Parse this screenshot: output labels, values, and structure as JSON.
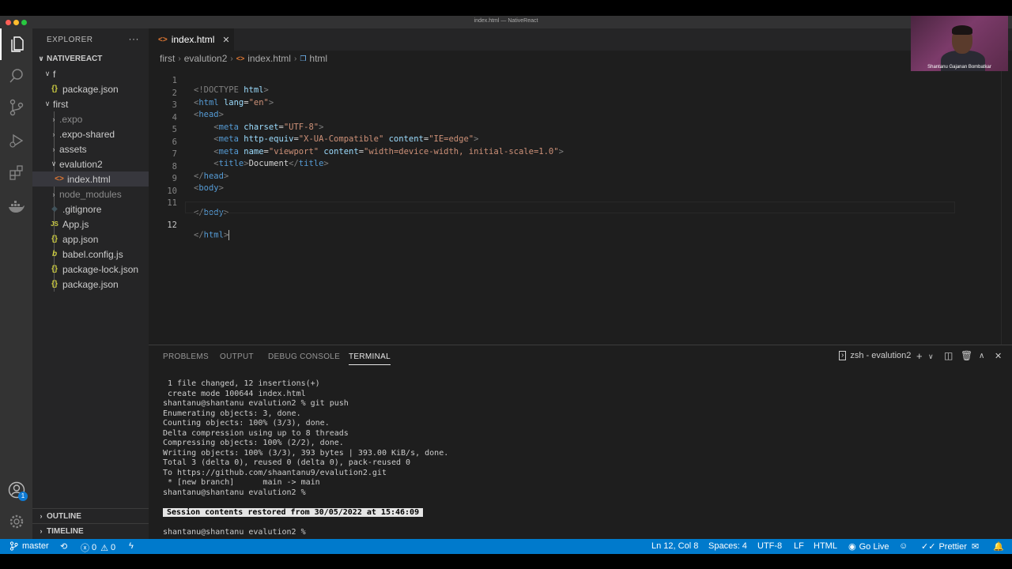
{
  "window": {
    "title": "index.html — NativeReact"
  },
  "explorer": {
    "header": "EXPLORER",
    "root": "NATIVEREACT",
    "items": [
      {
        "label": "f",
        "type": "folder-open"
      },
      {
        "label": "package.json",
        "type": "json"
      },
      {
        "label": "first",
        "type": "folder-open"
      },
      {
        "label": ".expo",
        "type": "folder"
      },
      {
        "label": ".expo-shared",
        "type": "folder"
      },
      {
        "label": "assets",
        "type": "folder"
      },
      {
        "label": "evalution2",
        "type": "folder-open"
      },
      {
        "label": "index.html",
        "type": "html"
      },
      {
        "label": "node_modules",
        "type": "folder"
      },
      {
        "label": ".gitignore",
        "type": "git"
      },
      {
        "label": "App.js",
        "type": "js"
      },
      {
        "label": "app.json",
        "type": "json"
      },
      {
        "label": "babel.config.js",
        "type": "babel"
      },
      {
        "label": "package-lock.json",
        "type": "json"
      },
      {
        "label": "package.json",
        "type": "json"
      }
    ],
    "outline": "OUTLINE",
    "timeline": "TIMELINE"
  },
  "editor": {
    "tab": "index.html",
    "breadcrumb": [
      "first",
      "evalution2",
      "index.html",
      "html"
    ],
    "line_numbers": [
      "1",
      "2",
      "3",
      "4",
      "5",
      "6",
      "7",
      "8",
      "9",
      "10",
      "11",
      "12"
    ]
  },
  "code": {
    "l1": [
      "<!DOCTYPE",
      "html",
      ">"
    ],
    "l2": [
      "<",
      "html",
      "lang",
      "=",
      "\"en\"",
      ">"
    ],
    "l3": [
      "<",
      "head",
      ">"
    ],
    "l4": [
      "<",
      "meta",
      "charset",
      "=",
      "\"UTF-8\"",
      ">"
    ],
    "l5": [
      "<",
      "meta",
      "http-equiv",
      "=",
      "\"X-UA-Compatible\"",
      "content",
      "=",
      "\"IE=edge\"",
      ">"
    ],
    "l6": [
      "<",
      "meta",
      "name",
      "=",
      "\"viewport\"",
      "content",
      "=",
      "\"width=device-width, initial-scale=1.0\"",
      ">"
    ],
    "l7": [
      "<",
      "title",
      ">",
      "Document",
      "</",
      "title",
      ">"
    ],
    "l8": [
      "</",
      "head",
      ">"
    ],
    "l9": [
      "<",
      "body",
      ">"
    ],
    "l11": [
      "</",
      "body",
      ">"
    ],
    "l12": [
      "</",
      "html",
      ">"
    ]
  },
  "panel": {
    "tabs": [
      "PROBLEMS",
      "OUTPUT",
      "DEBUG CONSOLE",
      "TERMINAL"
    ],
    "terminal_name": "zsh - evalution2",
    "terminal_lines": [
      " 1 file changed, 12 insertions(+)",
      " create mode 100644 index.html",
      "shantanu@shantanu evalution2 % git push",
      "Enumerating objects: 3, done.",
      "Counting objects: 100% (3/3), done.",
      "Delta compression using up to 8 threads",
      "Compressing objects: 100% (2/2), done.",
      "Writing objects: 100% (3/3), 393 bytes | 393.00 KiB/s, done.",
      "Total 3 (delta 0), reused 0 (delta 0), pack-reused 0",
      "To https://github.com/shaantanu9/evalution2.git",
      " * [new branch]      main -> main",
      "shantanu@shantanu evalution2 %"
    ],
    "session_restored": "Session contents restored from 30/05/2022 at 15:46:09",
    "final_prompt": "shantanu@shantanu evalution2 %"
  },
  "statusbar": {
    "branch": "master",
    "errors": "0",
    "warnings": "0",
    "position": "Ln 12, Col 8",
    "spaces": "Spaces: 4",
    "encoding": "UTF-8",
    "eol": "LF",
    "language": "HTML",
    "golive": "Go Live",
    "prettier": "Prettier"
  },
  "webcam": {
    "name": "Shantanu Gajanan Bombatkar"
  },
  "badges": {
    "accounts": "1"
  },
  "colors": {
    "statusbar": "#007acc",
    "tag": "#569cd6",
    "attribute": "#9cdcfe",
    "string": "#ce9178",
    "bracket": "#808080"
  }
}
